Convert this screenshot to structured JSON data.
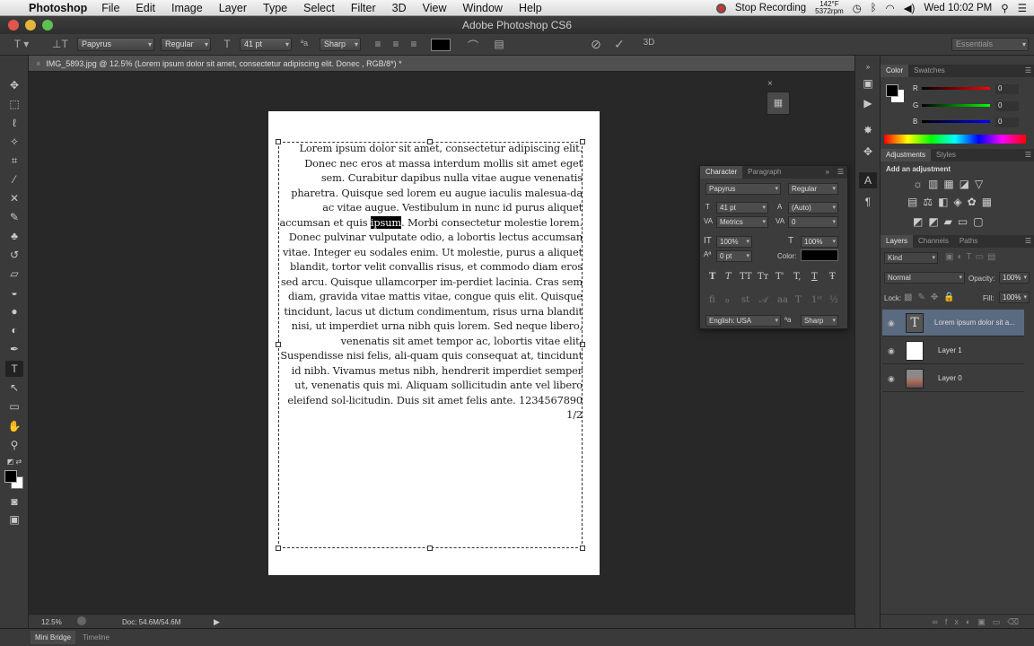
{
  "menubar": {
    "app_name": "Photoshop",
    "items": [
      "File",
      "Edit",
      "Image",
      "Layer",
      "Type",
      "Select",
      "Filter",
      "3D",
      "View",
      "Window",
      "Help"
    ],
    "recording": "Stop Recording",
    "temp_top": "142°F",
    "temp_bottom": "5372rpm",
    "clock": "Wed 10:02 PM"
  },
  "window": {
    "title": "Adobe Photoshop CS6"
  },
  "options_bar": {
    "font_family": "Papyrus",
    "font_style": "Regular",
    "font_size": "41 pt",
    "antialias": "Sharp",
    "workspace": "Essentials"
  },
  "document": {
    "tab_title": "IMG_5893.jpg @ 12.5% (Lorem ipsum dolor sit amet, consectetur adipiscing elit. Donec , RGB/8*) *",
    "text_before": "Lorem ipsum dolor sit amet, consectetur adipiscing elit. Donec nec eros at massa interdum mollis sit amet eget sem. Curabitur dapibus nulla vitae augue venenatis pharetra. Quisque sed lorem eu augue iaculis malesua-da ac vitae augue. Vestibulum in nunc id purus aliquet accumsan et quis ",
    "text_selected": "ipsum",
    "text_after": ". Morbi consectetur molestie lorem. Donec pulvinar vulputate odio, a lobortis lectus accumsan vitae. Integer eu sodales enim. Ut molestie, purus a aliquet blandit, tortor velit convallis risus, et commodo diam eros sed arcu. Quisque ullamcorper im-perdiet lacinia. Cras sem diam, gravida vitae mattis vitae, congue quis elit. Quisque tincidunt, lacus ut dictum condimentum, risus urna blandit nisi, ut imperdiet urna nibh quis lorem. Sed neque libero, venenatis sit amet tempor ac, lobortis vitae elit. Suspendisse nisi felis, ali-quam quis consequat at, tincidunt id nibh. Vivamus metus nibh, hendrerit imperdiet semper ut, venenatis quis mi. Aliquam sollicitudin ante vel libero eleifend sol-licitudin. Duis sit amet felis ante. 1234567890 1/2"
  },
  "status": {
    "zoom": "12.5%",
    "doc_size": "Doc: 54.6M/54.6M"
  },
  "bottom_tabs": [
    "Mini Bridge",
    "Timeline"
  ],
  "color_panel": {
    "tabs": [
      "Color",
      "Swatches"
    ],
    "r_label": "R",
    "g_label": "G",
    "b_label": "B",
    "r": "0",
    "g": "0",
    "b": "0"
  },
  "adjustments_panel": {
    "tabs": [
      "Adjustments",
      "Styles"
    ],
    "heading": "Add an adjustment"
  },
  "layers_panel": {
    "tabs": [
      "Layers",
      "Channels",
      "Paths"
    ],
    "filter": "Kind",
    "blend_mode": "Normal",
    "opacity_label": "Opacity:",
    "opacity": "100%",
    "lock_label": "Lock:",
    "fill_label": "Fill:",
    "fill": "100%",
    "layers": [
      {
        "name": "Lorem ipsum dolor sit a...",
        "kind": "text"
      },
      {
        "name": "Layer 1",
        "kind": "white"
      },
      {
        "name": "Layer 0",
        "kind": "photo"
      }
    ]
  },
  "character_panel": {
    "tabs": [
      "Character",
      "Paragraph"
    ],
    "font_family": "Papyrus",
    "font_style": "Regular",
    "size": "41 pt",
    "leading": "(Auto)",
    "kerning": "Metrics",
    "tracking": "0",
    "vscale": "100%",
    "hscale": "100%",
    "baseline": "0 pt",
    "color_label": "Color:",
    "type_buttons": [
      "T",
      "T",
      "TT",
      "Tт",
      "T'",
      "T,",
      "T",
      "Ŧ"
    ],
    "language": "English: USA",
    "antialias": "Sharp"
  },
  "colors": {
    "accent": "#f0f0f0",
    "panel_bg": "#3c3c3c",
    "canvas_bg": "#282828"
  }
}
